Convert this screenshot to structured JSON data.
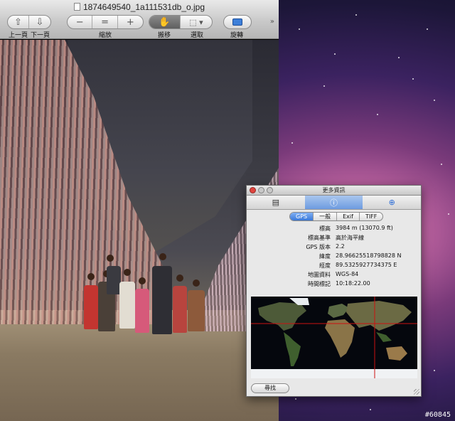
{
  "preview": {
    "title": "1874649540_1a111531db_o.jpg",
    "toolbar": {
      "prev_label": "上一頁",
      "next_label": "下一頁",
      "zoom_label": "縮放",
      "move_label": "搬移",
      "select_label": "選取",
      "rotate_label": "旋轉"
    }
  },
  "inspector": {
    "title": "更多資訊",
    "tabs": [
      {
        "label": "GPS",
        "active": true
      },
      {
        "label": "一般",
        "active": false
      },
      {
        "label": "Exif",
        "active": false
      },
      {
        "label": "TIFF",
        "active": false
      }
    ],
    "rows": [
      {
        "key": "標高",
        "value": "3984 m (13070.9 ft)"
      },
      {
        "key": "標高基準",
        "value": "高於海平線"
      },
      {
        "key": "GPS 版本",
        "value": "2.2"
      },
      {
        "key": "緯度",
        "value": "28.96625518798828 N"
      },
      {
        "key": "經度",
        "value": "89.5325927734375 E"
      },
      {
        "key": "地圖資料",
        "value": "WGS-84"
      },
      {
        "key": "時間標記",
        "value": "10:18:22.00"
      }
    ],
    "find_label": "尋找"
  },
  "watermark": "#60845",
  "colors": {
    "accent": "#3a79d8",
    "marker_line": "#cc1111"
  }
}
